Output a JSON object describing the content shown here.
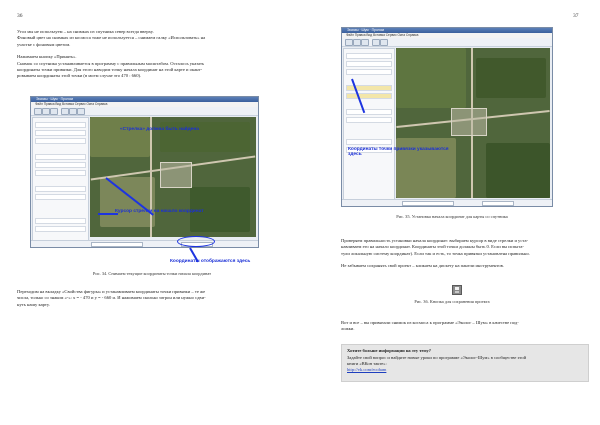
{
  "left_page": {
    "page_number": "36",
    "intro_lines": [
      "Угол мы не используем – на снимках из спутника север всегда вверху.",
      "Фоновый цвет на снимках из космоса тоже не используется – снимаем галку «Использовать» на",
      "участке с фоновым цветом.",
      "",
      "Нажимаем кнопку «Принять».",
      "Снимок со спутника устанавливается в программу с правильным масштабом. Осталось указать",
      "координаты точки привязки. Для этого наводим точку начала координат на этой карте и окант-",
      "ровываем координаты этой точки (в моем случае это 470 : 660)."
    ],
    "screenshot": {
      "window_title": "Эскизы · Шум · Пролом",
      "menu": "Файл  Правка  Вид  Вставка  Сервис  Окна  Справка",
      "annot_top": "«Стрелка» должна быть найдена",
      "annot_mid": "Курсор стрелки на начало координат",
      "annot_bottom": "Координаты отображаются здесь",
      "status_coords": "470 : 660"
    },
    "caption": "Рис. 34. Снимаем текущие координаты точки начала координат",
    "body_lines": [
      "Переходим на вкладку «Свойства фигуры» и устанавливаем координаты точки привязки – те же",
      "числа, только со знаком «-»:  x = - 470 и y = - 660 и. И нажимаем сколько затрон или нужно сдви-",
      "нуть нашу карту."
    ]
  },
  "right_page": {
    "page_number": "37",
    "screenshot": {
      "window_title": "Эскизы · Шум · Пролом",
      "menu": "Файл  Правка  Вид  Вставка  Сервис  Окна  Справка",
      "annot": "Координаты точки привязки указываются здесь"
    },
    "caption1": "Рис. 35. Установка начала координат для карты со спутника",
    "body_lines": [
      "Проверяем правильность установки начала координат: выбираем курсор в виде стрелки и уста-",
      "навливаем его на начало координат. Координаты этой точки должны быть 0. Если вы испыта-",
      "тули локальную систему координат). Если так и есть, то точка привязки установлена правильно.",
      "",
      "Не забываем сохранять свой проект – кликаем на дискету на панели инструментов."
    ],
    "caption2": "Рис. 36. Кнопка для сохранения проекта",
    "outro_lines": [
      "Вот и все – вы привязали снимок из космоса к программе «Эколог – Шум» в качестве под-",
      "ложки."
    ],
    "info_box": {
      "heading": "Хотите больше информации на эту тему?",
      "line1": "Задайте свой вопрос и найдите новые уроки по программе «Эколог-Шум» в сообществе этой",
      "line2": "книги «ВКон такте»:",
      "link": "http://vk.com/ecoham"
    }
  }
}
